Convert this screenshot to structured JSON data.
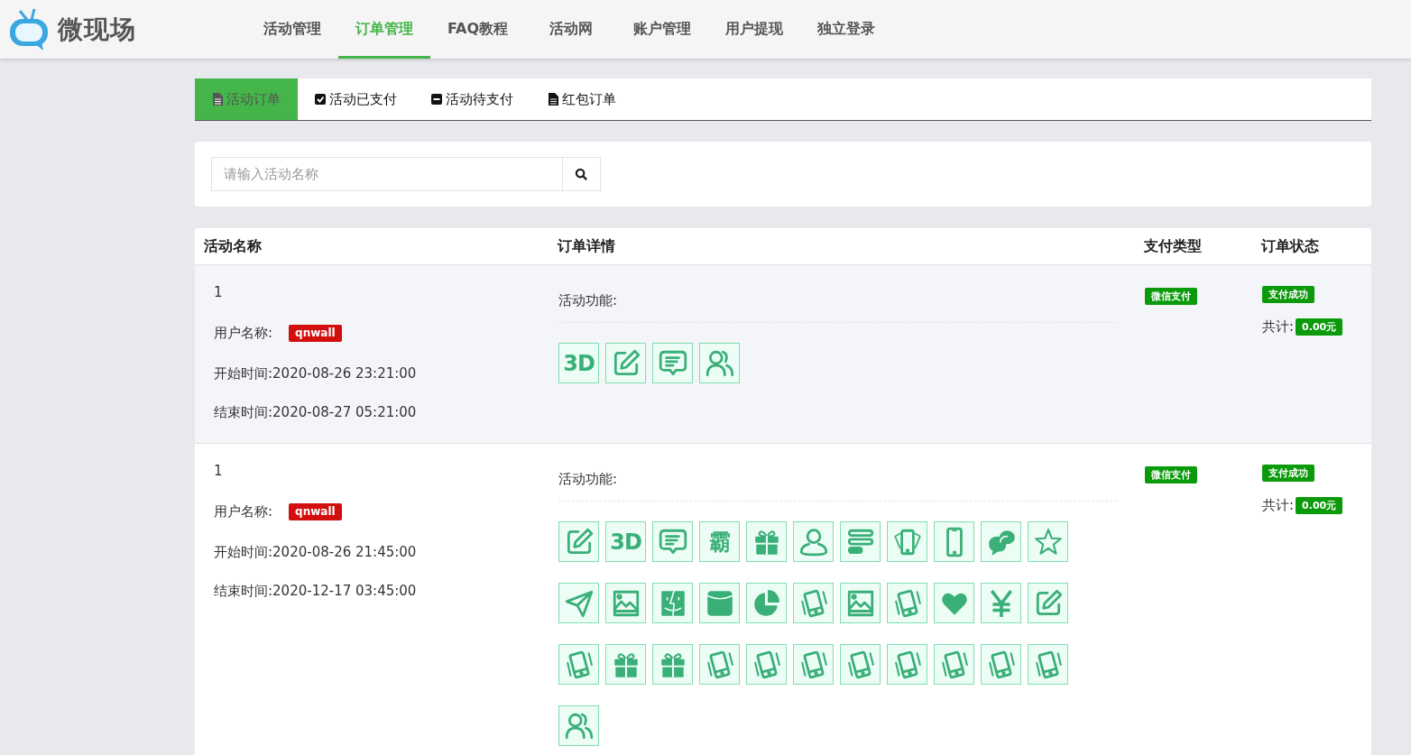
{
  "logo": {
    "text": "微现场"
  },
  "nav": [
    {
      "label": "活动管理",
      "selected": false
    },
    {
      "label": "订单管理",
      "selected": true
    },
    {
      "label": "FAQ教程",
      "selected": false
    },
    {
      "label": "活动网",
      "selected": false
    },
    {
      "label": "账户管理",
      "selected": false
    },
    {
      "label": "用户提现",
      "selected": false
    },
    {
      "label": "独立登录",
      "selected": false
    }
  ],
  "tabs": [
    {
      "label": "活动订单",
      "kind": "file",
      "selected": true
    },
    {
      "label": "活动已支付",
      "kind": "check",
      "selected": false
    },
    {
      "label": "活动待支付",
      "kind": "minus",
      "selected": false
    },
    {
      "label": "红包订单",
      "kind": "file",
      "selected": false
    }
  ],
  "search": {
    "placeholder": "请输入活动名称"
  },
  "table": {
    "columns": [
      "活动名称",
      "订单详情",
      "支付类型",
      "订单状态"
    ],
    "rows": [
      {
        "id": "1",
        "user_label": "用户名称:",
        "user": "qnwall",
        "start": "开始时间:2020-08-26 23:21:00",
        "end": "结束时间:2020-08-27 05:21:00",
        "features_label": "活动功能:",
        "features": [
          {
            "kind": "glyph",
            "text": "3D"
          },
          {
            "kind": "edit"
          },
          {
            "kind": "chat"
          },
          {
            "kind": "users"
          }
        ],
        "pay_type": "微信支付",
        "status": "支付成功",
        "total_label": "共计:",
        "total": "0.00元"
      },
      {
        "id": "1",
        "user_label": "用户名称:",
        "user": "qnwall",
        "start": "开始时间:2020-08-26 21:45:00",
        "end": "结束时间:2020-12-17 03:45:00",
        "features_label": "活动功能:",
        "features": [
          {
            "kind": "edit"
          },
          {
            "kind": "glyph",
            "text": "3D"
          },
          {
            "kind": "chat"
          },
          {
            "kind": "glyph",
            "text": "霸"
          },
          {
            "kind": "gift"
          },
          {
            "kind": "user"
          },
          {
            "kind": "bars"
          },
          {
            "kind": "phones"
          },
          {
            "kind": "phone"
          },
          {
            "kind": "bubbles"
          },
          {
            "kind": "star"
          },
          {
            "kind": "send"
          },
          {
            "kind": "image"
          },
          {
            "kind": "finder"
          },
          {
            "kind": "wallet"
          },
          {
            "kind": "pie"
          },
          {
            "kind": "shake"
          },
          {
            "kind": "image"
          },
          {
            "kind": "shake"
          },
          {
            "kind": "heart"
          },
          {
            "kind": "yen"
          },
          {
            "kind": "edit"
          },
          {
            "kind": "shake"
          },
          {
            "kind": "gift"
          },
          {
            "kind": "gift"
          },
          {
            "kind": "shake"
          },
          {
            "kind": "shake"
          },
          {
            "kind": "shake"
          },
          {
            "kind": "shake"
          },
          {
            "kind": "shake"
          },
          {
            "kind": "shake"
          },
          {
            "kind": "shake"
          },
          {
            "kind": "shake"
          },
          {
            "kind": "users"
          }
        ],
        "pay_type": "微信支付",
        "status": "支付成功",
        "total_label": "共计:",
        "total": "0.00元"
      }
    ]
  }
}
